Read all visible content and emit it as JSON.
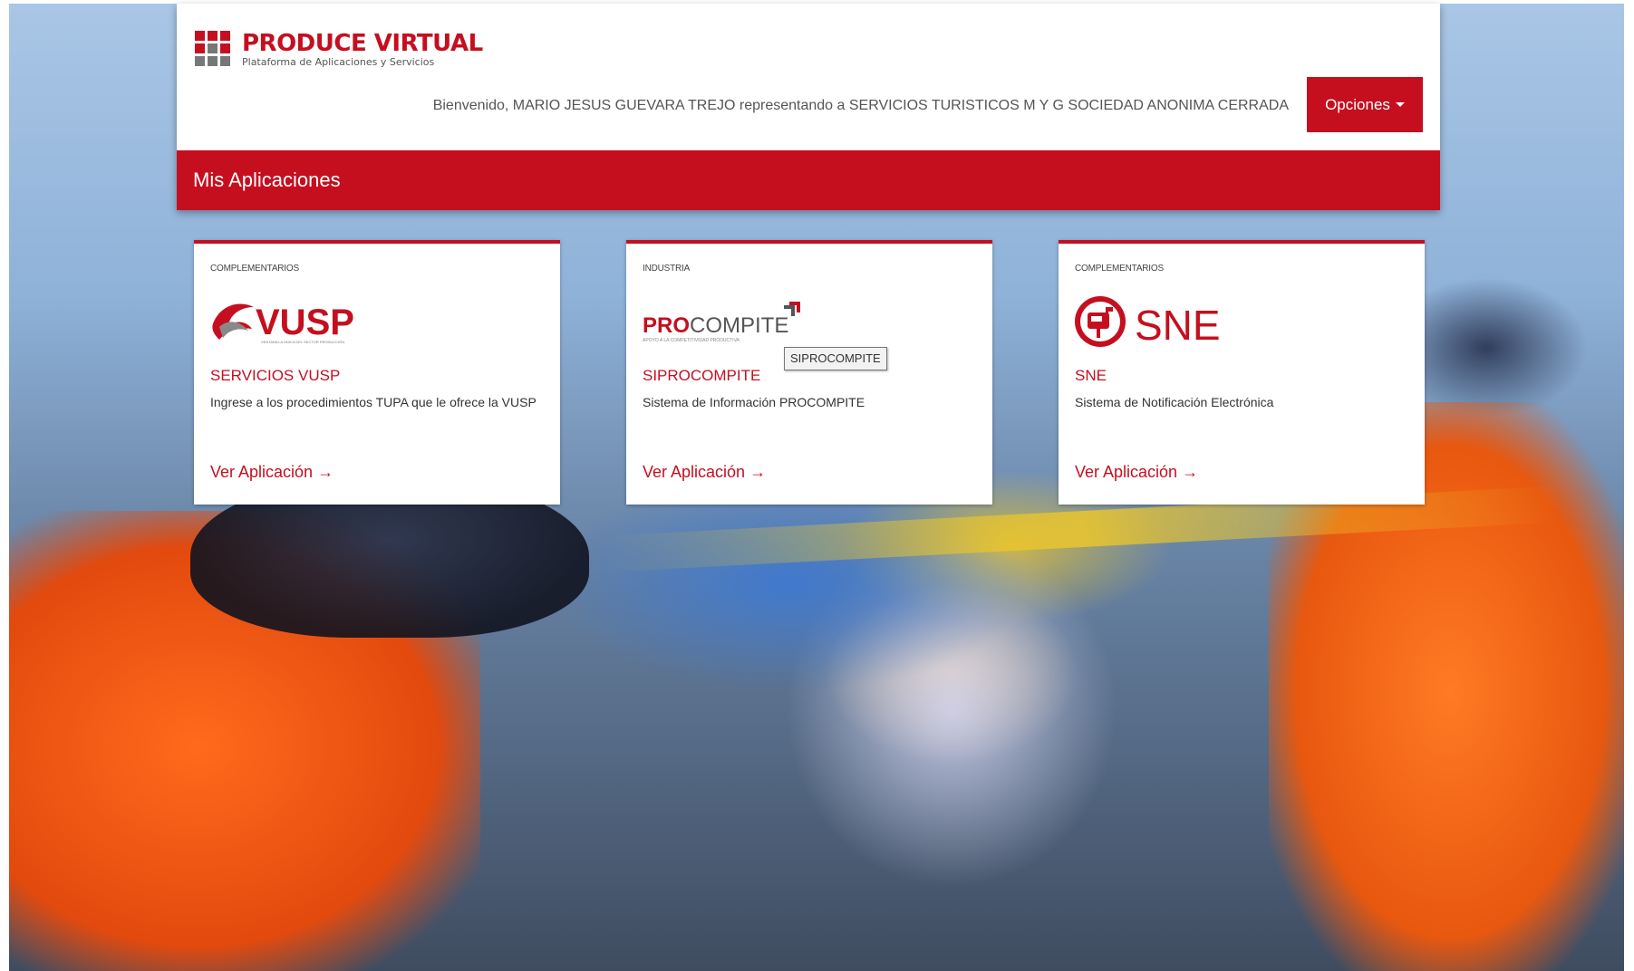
{
  "brand": {
    "title": "PRODUCE VIRTUAL",
    "subtitle": "Plataforma de Aplicaciones y Servicios",
    "color": "#c50f1f"
  },
  "header": {
    "welcome": "Bienvenido, MARIO JESUS GUEVARA TREJO representando a SERVICIOS TURISTICOS M Y G SOCIEDAD ANONIMA CERRADA",
    "options_label": "Opciones"
  },
  "section": {
    "title": "Mis Aplicaciones"
  },
  "cards": [
    {
      "category": "COMPLEMENTARIOS",
      "logo_text": "VUSP",
      "logo_caption": "VENTANILLA ÚNICA DEL SECTOR PRODUCCIÓN",
      "title": "SERVICIOS VUSP",
      "description": "Ingrese a los procedimientos TUPA que le ofrece la VUSP",
      "link": "Ver Aplicación →"
    },
    {
      "category": "INDUSTRIA",
      "logo_text_a": "PRO",
      "logo_text_b": "COMPITE",
      "logo_caption": "APOYO A LA COMPETITIVIDAD PRODUCTIVA",
      "title": "SIPROCOMPITE",
      "description": "Sistema de Información PROCOMPITE",
      "link": "Ver Aplicación →"
    },
    {
      "category": "COMPLEMENTARIOS",
      "logo_text": "SNE",
      "title": "SNE",
      "description": "Sistema de Notificación Electrónica",
      "link": "Ver Aplicación →"
    }
  ],
  "tooltip": "SIPROCOMPITE"
}
